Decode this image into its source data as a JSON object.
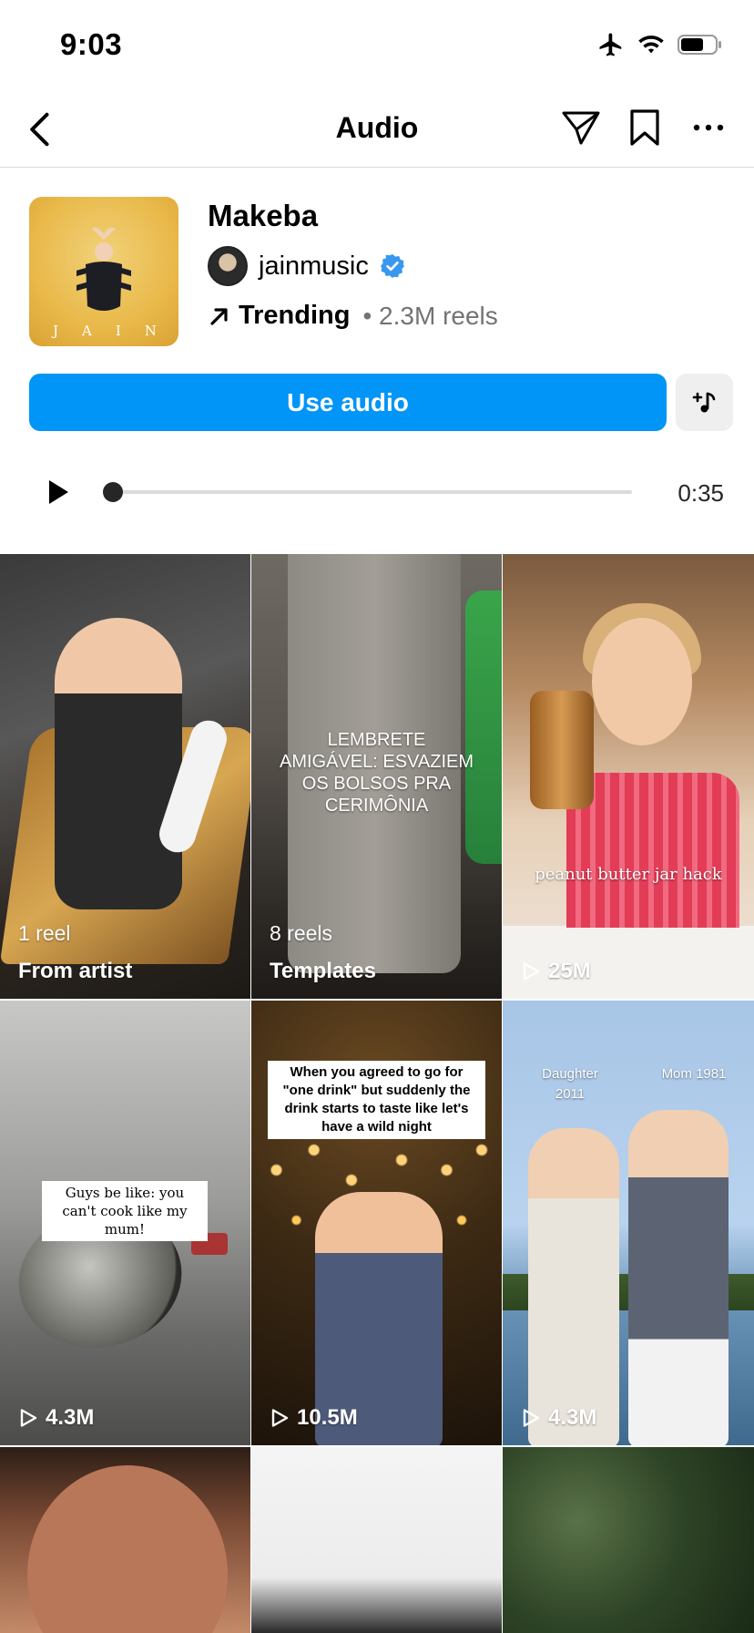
{
  "status_bar": {
    "time": "9:03"
  },
  "nav": {
    "title": "Audio"
  },
  "audio": {
    "track_title": "Makeba",
    "album_text": "JAIN",
    "artist": "jainmusic",
    "trend_label": "Trending",
    "reels_count": "• 2.3M reels",
    "use_audio_label": "Use audio",
    "duration": "0:35",
    "progress_fraction": 0.0
  },
  "tiles": [
    {
      "top_text": "1 reel",
      "bottom_text": "From artist"
    },
    {
      "caption": "LEMBRETE AMIGÁVEL: ESVAZIEM OS BOLSOS PRA CERIMÔNIA",
      "top_text": "8 reels",
      "bottom_text": "Templates"
    },
    {
      "caption": "peanut butter jar hack",
      "views": "25M"
    },
    {
      "caption": "Guys be like: you can't cook like my mum!",
      "views": "4.3M"
    },
    {
      "caption": "When you agreed to go for \"one drink\" but suddenly the drink starts to taste like let's have a wild night",
      "views": "10.5M"
    },
    {
      "caption_left": "Daughter 2011",
      "caption_right": "Mom 1981",
      "views": "4.3M"
    }
  ],
  "colors": {
    "accent": "#0095f6",
    "verified": "#3897f0"
  }
}
